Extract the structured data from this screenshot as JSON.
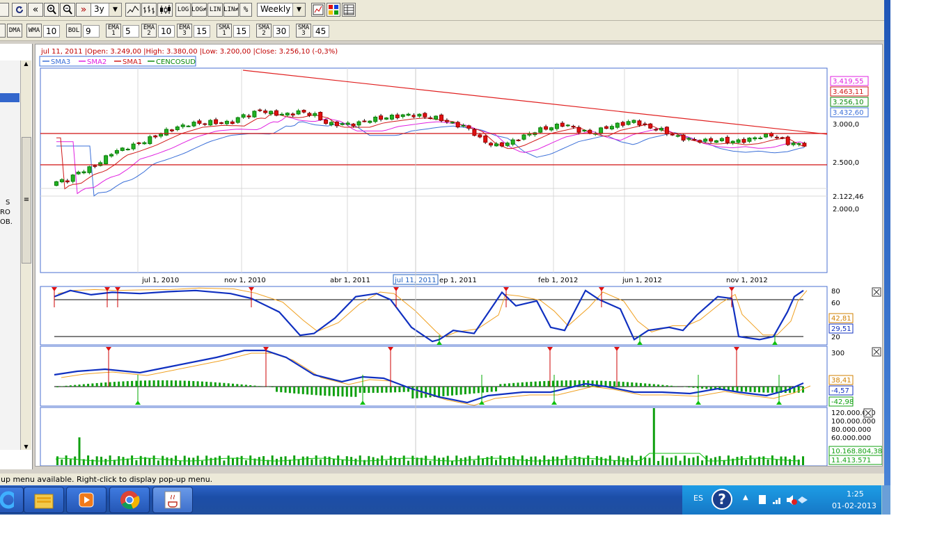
{
  "toolbar": {
    "period": "3y",
    "interval": "Weekly",
    "buttons": [
      {
        "name": "reload-button",
        "label": ""
      },
      {
        "name": "scroll-back-button",
        "label": "«"
      },
      {
        "name": "zoom-in-button",
        "label": ""
      },
      {
        "name": "zoom-out-button",
        "label": ""
      },
      {
        "name": "scroll-forward-button",
        "label": "»"
      }
    ],
    "chart_types": [
      "line-chart-icon",
      "bar-chart-icon",
      "candle-chart-icon"
    ],
    "scale_buttons": [
      "LOG",
      "LOG≠",
      "LIN",
      "LIN≠",
      "%"
    ],
    "indicators": [
      {
        "label": "DMA",
        "value": ""
      },
      {
        "label": "WMA",
        "value": "10"
      },
      {
        "label": "BOL",
        "value": "9"
      },
      {
        "label": "EMA 1",
        "value": "5"
      },
      {
        "label": "EMA 2",
        "value": "10"
      },
      {
        "label": "EMA 3",
        "value": "15"
      },
      {
        "label": "SMA 1",
        "value": "15"
      },
      {
        "label": "SMA 2",
        "value": "30"
      },
      {
        "label": "SMA 3",
        "value": "45"
      }
    ]
  },
  "sidebar": {
    "text_lines": [
      "S",
      "RO",
      "OB."
    ]
  },
  "chart": {
    "info": "jul 11, 2011 |Open: 3.249,00 |High: 3.380,00 |Low: 3.200,00 |Close: 3.256,10 (-0,3%)",
    "legend": [
      {
        "name": "SMA3",
        "color": "#3a6fd8"
      },
      {
        "name": "SMA2",
        "color": "#e020e0"
      },
      {
        "name": "SMA1",
        "color": "#d01818"
      },
      {
        "name": "CENCOSUD",
        "color": "#0a8a0a"
      }
    ],
    "price_labels": [
      "3.419,55",
      "3.463,11",
      "3.256,10",
      "3.432,60",
      "3.000,0",
      "2.500,0",
      "2.122,46",
      "2.000,0"
    ],
    "x_labels": [
      "jul 1, 2010",
      "nov 1, 2010",
      "abr 1, 2011",
      "jul 11, 2011",
      "ep 1, 2011",
      "feb 1, 2012",
      "jun 1, 2012",
      "nov 1, 2012"
    ],
    "stoch": {
      "levels": [
        "80",
        "60",
        "42,81",
        "29,51",
        "20"
      ]
    },
    "macd": {
      "levels": [
        "300",
        "38,41",
        "-4,57",
        "-42,98"
      ]
    },
    "volume": {
      "levels": [
        "120.000.000",
        "100.000.000",
        "80.000.000",
        "60.000.000",
        "10.168.804,38",
        "11.413.571"
      ]
    }
  },
  "status_text": "up menu available. Right-click to display pop-up menu.",
  "taskbar": {
    "apps": [
      "ie-icon",
      "file-explorer-icon",
      "media-player-icon",
      "chrome-icon",
      "java-icon"
    ],
    "lang": "ES",
    "time": "1:25",
    "date": "01-02-2013"
  }
}
